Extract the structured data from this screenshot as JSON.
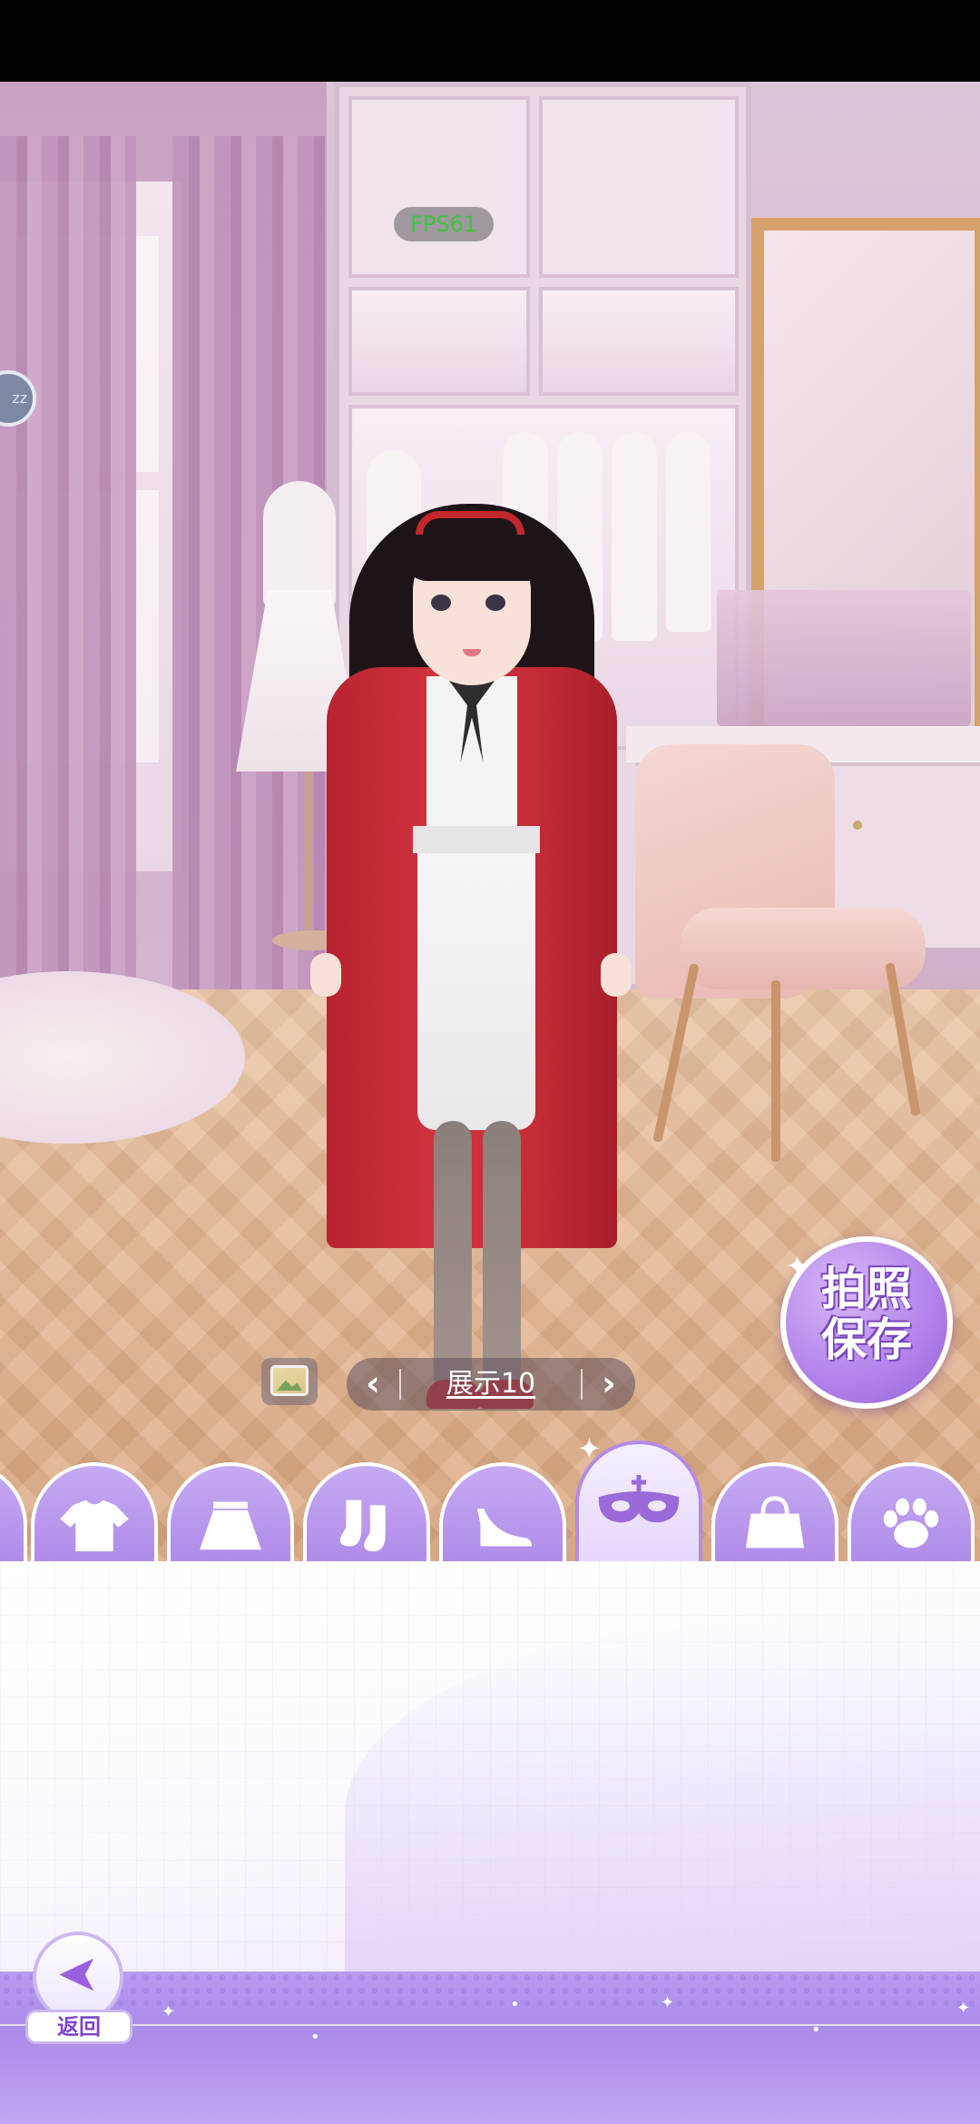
{
  "overlay": {
    "fps_text": "FPS61",
    "side_bubble_text": "zz"
  },
  "actions": {
    "photo_save_line1": "拍照",
    "photo_save_line2": "保存"
  },
  "outfit_nav": {
    "prev_icon": "chevron-left-icon",
    "next_icon": "chevron-right-icon",
    "current_label": "展示10"
  },
  "category_tabs": [
    {
      "icon": "shirt-icon",
      "active": false
    },
    {
      "icon": "skirt-icon",
      "active": false
    },
    {
      "icon": "socks-icon",
      "active": false
    },
    {
      "icon": "high-heel-icon",
      "active": false
    },
    {
      "icon": "mask-icon",
      "active": true
    },
    {
      "icon": "handbag-icon",
      "active": false
    },
    {
      "icon": "paw-icon",
      "active": false
    }
  ],
  "bottom": {
    "back_label": "返回"
  },
  "colors": {
    "accent_purple": "#b38ae8",
    "coat_red": "#c52c37",
    "fps_green": "#3ec43e"
  }
}
